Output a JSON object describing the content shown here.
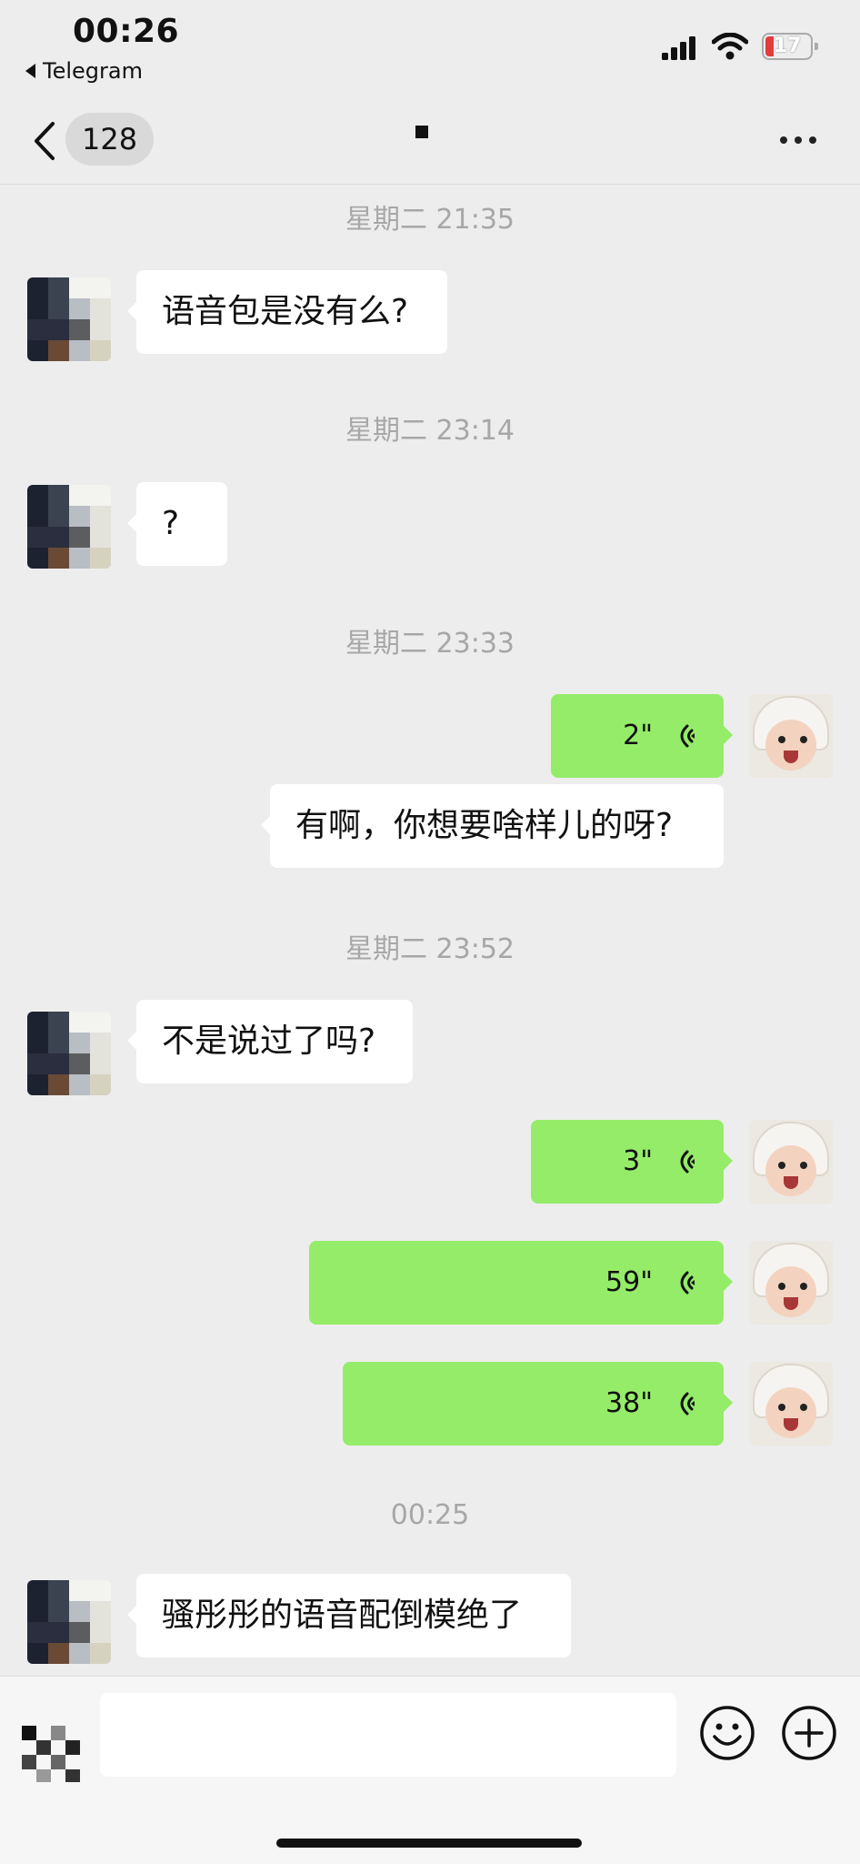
{
  "status_bar": {
    "time": "00:26",
    "back_app": "Telegram",
    "battery": "17"
  },
  "nav": {
    "unread_count": "128",
    "icons": [
      "chevron-left-icon",
      "more-icon"
    ]
  },
  "messages": [
    {
      "type": "timestamp",
      "text": "星期二 21:35"
    },
    {
      "type": "text",
      "side": "left",
      "text": "语音包是没有么?"
    },
    {
      "type": "timestamp",
      "text": "星期二 23:14"
    },
    {
      "type": "text",
      "side": "left",
      "text": "?"
    },
    {
      "type": "timestamp",
      "text": "星期二 23:33"
    },
    {
      "type": "voice",
      "side": "right",
      "duration": "2\""
    },
    {
      "type": "text",
      "side": "right",
      "text": "有啊，你想要啥样儿的呀?"
    },
    {
      "type": "timestamp",
      "text": "星期二 23:52"
    },
    {
      "type": "text",
      "side": "left",
      "text": "不是说过了吗?"
    },
    {
      "type": "voice",
      "side": "right",
      "duration": "3\""
    },
    {
      "type": "voice",
      "side": "right",
      "duration": "59\""
    },
    {
      "type": "voice",
      "side": "right",
      "duration": "38\""
    },
    {
      "type": "timestamp",
      "text": "00:25"
    },
    {
      "type": "text",
      "side": "left",
      "text": "骚彤彤的语音配倒模绝了"
    }
  ],
  "input_bar": {
    "placeholder": "",
    "icons": [
      "voice-toggle-icon",
      "emoji-icon",
      "plus-icon"
    ]
  },
  "colors": {
    "background": "#ededed",
    "outgoing_bubble": "#95ec69",
    "incoming_bubble": "#ffffff",
    "timestamp": "#a7a7a7"
  }
}
